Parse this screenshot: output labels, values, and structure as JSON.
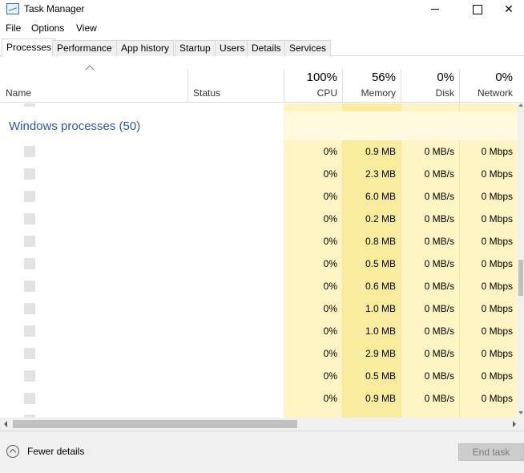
{
  "window": {
    "title": "Task Manager"
  },
  "menu": [
    "File",
    "Options",
    "View"
  ],
  "tabs": [
    "Processes",
    "Performance",
    "App history",
    "Startup",
    "Users",
    "Details",
    "Services"
  ],
  "active_tab": "Processes",
  "columns": {
    "name": "Name",
    "status": "Status",
    "cpu": {
      "percent": "100%",
      "label": "CPU"
    },
    "memory": {
      "percent": "56%",
      "label": "Memory"
    },
    "disk": {
      "percent": "0%",
      "label": "Disk"
    },
    "network": {
      "percent": "0%",
      "label": "Network"
    }
  },
  "group": {
    "label": "Windows processes (50)"
  },
  "rows": [
    {
      "cpu": "0%",
      "memory": "0.9 MB",
      "disk": "0 MB/s",
      "network": "0 Mbps"
    },
    {
      "cpu": "0%",
      "memory": "2.3 MB",
      "disk": "0 MB/s",
      "network": "0 Mbps"
    },
    {
      "cpu": "0%",
      "memory": "6.0 MB",
      "disk": "0 MB/s",
      "network": "0 Mbps"
    },
    {
      "cpu": "0%",
      "memory": "0.2 MB",
      "disk": "0 MB/s",
      "network": "0 Mbps"
    },
    {
      "cpu": "0%",
      "memory": "0.8 MB",
      "disk": "0 MB/s",
      "network": "0 Mbps"
    },
    {
      "cpu": "0%",
      "memory": "0.5 MB",
      "disk": "0 MB/s",
      "network": "0 Mbps"
    },
    {
      "cpu": "0%",
      "memory": "0.6 MB",
      "disk": "0 MB/s",
      "network": "0 Mbps"
    },
    {
      "cpu": "0%",
      "memory": "1.0 MB",
      "disk": "0 MB/s",
      "network": "0 Mbps"
    },
    {
      "cpu": "0%",
      "memory": "1.0 MB",
      "disk": "0 MB/s",
      "network": "0 Mbps"
    },
    {
      "cpu": "0%",
      "memory": "2.9 MB",
      "disk": "0 MB/s",
      "network": "0 Mbps"
    },
    {
      "cpu": "0%",
      "memory": "0.5 MB",
      "disk": "0 MB/s",
      "network": "0 Mbps"
    },
    {
      "cpu": "0%",
      "memory": "0.9 MB",
      "disk": "0 MB/s",
      "network": "0 Mbps"
    }
  ],
  "footer": {
    "fewer_details": "Fewer details",
    "end_task": "End task"
  },
  "colors": {
    "group_label": "#2c5aa0",
    "cpu_band": "#fff4c4",
    "memory_band": "#f9ec9e"
  }
}
